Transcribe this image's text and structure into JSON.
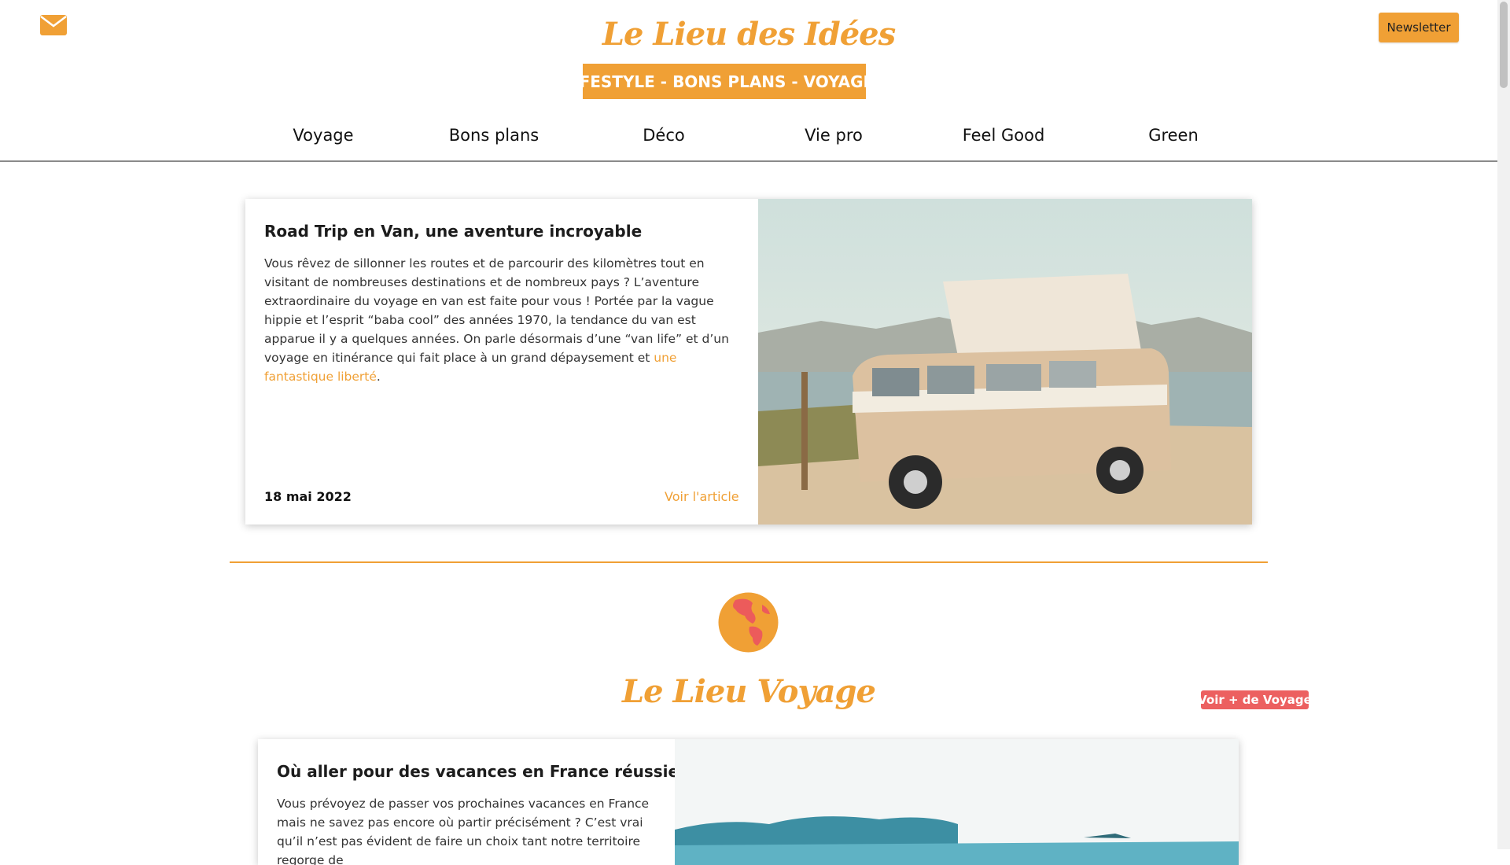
{
  "header": {
    "site_title": "Le Lieu des Idées",
    "tagline": "LIFESTYLE - BONS PLANS - VOYAGES",
    "newsletter_label": "Newsletter",
    "mail_icon": "envelope-icon"
  },
  "nav": {
    "items": [
      {
        "label": "Voyage"
      },
      {
        "label": "Bons plans"
      },
      {
        "label": "Déco"
      },
      {
        "label": "Vie pro"
      },
      {
        "label": "Feel Good"
      },
      {
        "label": "Green"
      }
    ]
  },
  "featured": {
    "title": "Road Trip en Van, une aventure incroyable",
    "excerpt": "Vous rêvez de sillonner les routes et de parcourir des kilomètres tout en visitant de nombreuses destinations et de nombreux pays ? L’aventure extraordinaire du voyage en van est faite pour vous ! Portée par la vague hippie et l’esprit “baba cool” des années 1970, la tendance du van est apparue il y a quelques années. On parle désormais d’une “van life” et d’un voyage en itinérance qui fait place à un grand dépaysement et ",
    "excerpt_link": "une fantastique liberté",
    "excerpt_end": ".",
    "date": "18 mai 2022",
    "cta": "Voir l'article"
  },
  "voyage_section": {
    "icon": "globe-icon",
    "title": "Le Lieu Voyage",
    "more_label": "Voir + de Voyage",
    "article": {
      "title": "Où aller pour des vacances en France réussies ?",
      "excerpt": "Vous prévoyez de passer vos prochaines vacances en France mais ne savez pas encore où partir précisément ? C’est vrai qu’il n’est pas évident de faire un choix tant notre territoire regorge de"
    }
  },
  "colors": {
    "accent": "#f0a035",
    "button_red": "#ec6060",
    "nav_border": "#8a8a8a"
  }
}
